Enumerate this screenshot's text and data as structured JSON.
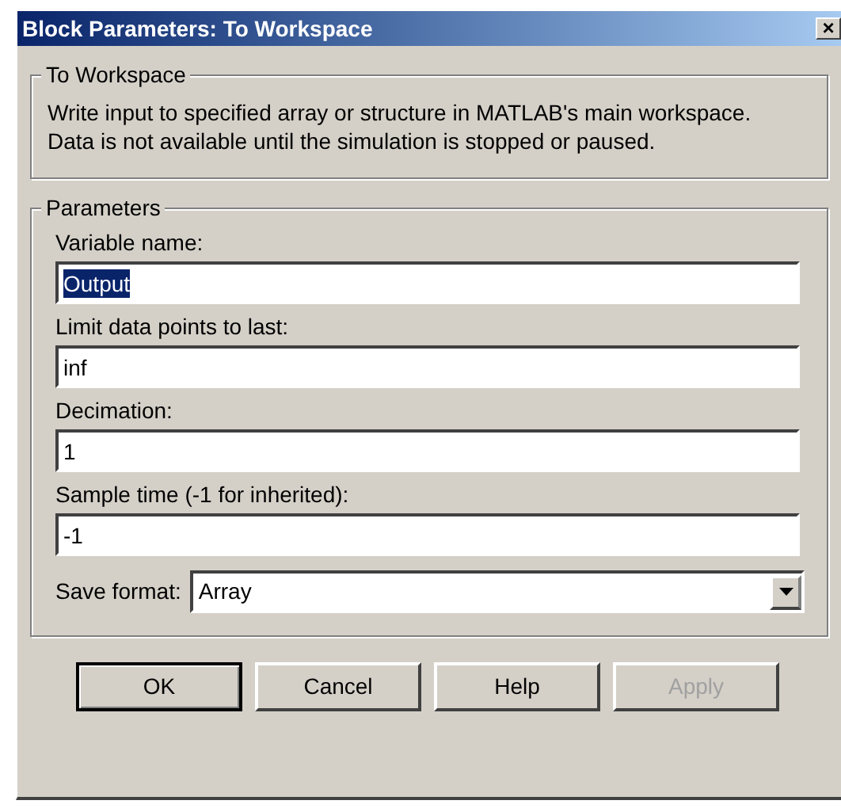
{
  "window": {
    "title": "Block Parameters: To Workspace",
    "close": "×"
  },
  "description_group": {
    "title": "To Workspace",
    "text": "Write input to specified array or structure in MATLAB's main workspace.\nData is not available until the simulation is stopped or paused."
  },
  "parameters_group": {
    "title": "Parameters",
    "fields": [
      {
        "kind": "text",
        "label": "Variable name:",
        "value": "Output",
        "selected": true
      },
      {
        "kind": "text",
        "label": "Limit data points to last:",
        "value": "inf",
        "selected": false
      },
      {
        "kind": "text",
        "label": "Decimation:",
        "value": "1",
        "selected": false
      },
      {
        "kind": "text",
        "label": "Sample time (-1 for inherited):",
        "value": "-1",
        "selected": false
      },
      {
        "kind": "dropdown",
        "label": "Save format:",
        "value": "Array",
        "selected": false
      }
    ]
  },
  "buttons": [
    {
      "label": "OK",
      "default": true,
      "disabled": false
    },
    {
      "label": "Cancel",
      "default": false,
      "disabled": false
    },
    {
      "label": "Help",
      "default": false,
      "disabled": false
    },
    {
      "label": "Apply",
      "default": false,
      "disabled": true
    }
  ]
}
